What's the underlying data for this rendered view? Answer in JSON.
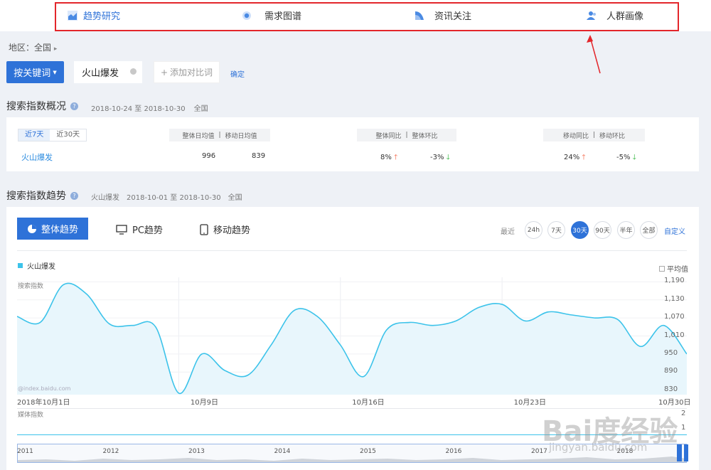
{
  "nav": {
    "items": [
      {
        "label": "趋势研究",
        "active": true
      },
      {
        "label": "需求图谱",
        "active": false
      },
      {
        "label": "资讯关注",
        "active": false
      },
      {
        "label": "人群画像",
        "active": false
      }
    ]
  },
  "region": {
    "label": "地区：全国"
  },
  "keyword_bar": {
    "button_label": "按关键词",
    "keyword": "火山爆发",
    "add_compare": "添加对比词",
    "confirm": "确定"
  },
  "overview": {
    "title": "搜索指数概况",
    "date_range": "2018-10-24 至 2018-10-30",
    "area": "全国",
    "period_tabs": [
      "近7天",
      "近30天"
    ],
    "col_avg": "整体日均值",
    "col_mobile_avg": "移动日均值",
    "col_yoy": "整体同比",
    "col_mom": "整体环比",
    "col_mobile_yoy": "移动同比",
    "col_mobile_mom": "移动环比",
    "keyword": "火山爆发",
    "avg_value": "996",
    "mobile_avg_value": "839",
    "yoy": "8%",
    "mom": "-3%",
    "mobile_yoy": "24%",
    "mobile_mom": "-5%"
  },
  "trend": {
    "title": "搜索指数趋势",
    "keyword": "火山爆发",
    "date_range": "2018-10-01 至 2018-10-30",
    "area": "全国",
    "tab_overall": "整体趋势",
    "tab_pc": "PC趋势",
    "tab_mobile": "移动趋势",
    "range_label": "最近",
    "ranges": [
      "24h",
      "7天",
      "30天",
      "90天",
      "半年",
      "全部"
    ],
    "active_range": "30天",
    "custom": "自定义",
    "average_label": "平均值",
    "search_index_label": "搜索指数",
    "media_index_label": "媒体指数",
    "source": "@index.baidu.com",
    "media_ticks": [
      "2",
      "1"
    ],
    "years": [
      "2011",
      "2012",
      "2013",
      "2014",
      "2015",
      "2016",
      "2017",
      "2018"
    ]
  },
  "chart_data": {
    "type": "area",
    "series": [
      {
        "name": "火山爆发",
        "color": "#3cc3ea"
      }
    ],
    "x": [
      "10-01",
      "10-02",
      "10-03",
      "10-04",
      "10-05",
      "10-06",
      "10-07",
      "10-08",
      "10-09",
      "10-10",
      "10-11",
      "10-12",
      "10-13",
      "10-14",
      "10-15",
      "10-16",
      "10-17",
      "10-18",
      "10-19",
      "10-20",
      "10-21",
      "10-22",
      "10-23",
      "10-24",
      "10-25",
      "10-26",
      "10-27",
      "10-28",
      "10-29",
      "10-30"
    ],
    "values": [
      1075,
      1055,
      1180,
      1150,
      1050,
      1045,
      1040,
      820,
      950,
      895,
      880,
      980,
      1095,
      1075,
      980,
      875,
      1030,
      1055,
      1045,
      1060,
      1105,
      1115,
      1060,
      1090,
      1080,
      1070,
      1065,
      975,
      1045,
      950
    ],
    "x_tick_labels": [
      "2018年10月1日",
      "10月9日",
      "10月16日",
      "10月23日",
      "10月30日"
    ],
    "y_ticks": [
      1190,
      1130,
      1070,
      1010,
      950,
      890,
      830
    ],
    "ylim": [
      815,
      1205
    ],
    "grid": true,
    "legend": "top-left"
  },
  "watermark": {
    "brand": "Bai度经验",
    "url": "jingyan.baidu.com"
  }
}
